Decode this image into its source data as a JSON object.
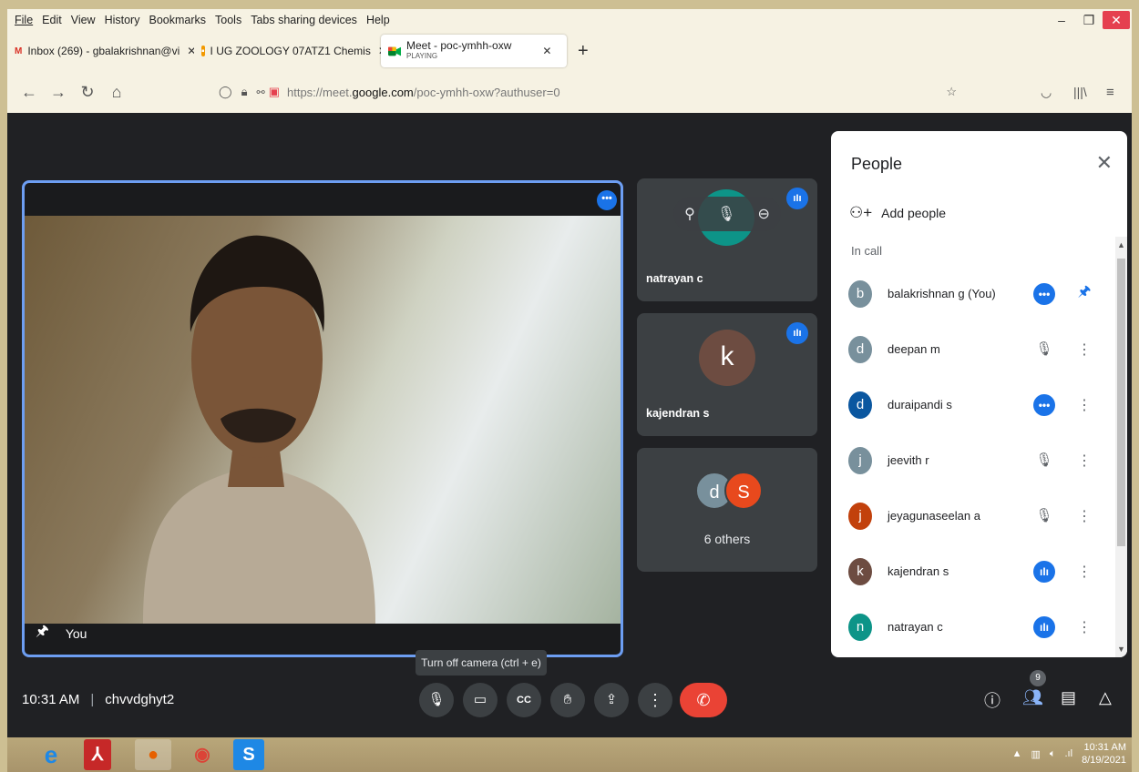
{
  "menubar": {
    "items": [
      "File",
      "Edit",
      "View",
      "History",
      "Bookmarks",
      "Tools",
      "Tabs sharing devices",
      "Help"
    ]
  },
  "tabs": [
    {
      "label": "Inbox (269) - gbalakrishnan@vi",
      "icon": "gmail-icon",
      "color": "#d93025"
    },
    {
      "label": "I UG ZOOLOGY 07ATZ1 Chemis",
      "icon": "classroom-icon",
      "color": "#f29900"
    },
    {
      "label": "Meet - poc-ymhh-oxw",
      "sub": "PLAYING",
      "icon": "meet-icon",
      "active": true
    }
  ],
  "navbar": {
    "url_prefix": "https://meet.",
    "url_domain": "google.com",
    "url_rest": "/poc-ymhh-oxw?authuser=0"
  },
  "main": {
    "self_label": "You"
  },
  "side_tiles": [
    {
      "name": "natrayan c",
      "color": "#0d9488"
    },
    {
      "name": "kajendran s",
      "avatar": "k",
      "color": "#6d4c41"
    },
    {
      "others_text": "6 others",
      "avatars": [
        {
          "letter": "d",
          "color": "#78909c"
        },
        {
          "letter": "S",
          "color": "#e8491d"
        }
      ]
    }
  ],
  "people_panel": {
    "title": "People",
    "add_label": "Add people",
    "section": "In call",
    "participants": [
      {
        "avatar": "b",
        "name": "balakrishnan g (You)",
        "color": "#78909c",
        "status": "more",
        "action": "pin"
      },
      {
        "avatar": "d",
        "name": "deepan m",
        "color": "#78909c",
        "status": "muted",
        "action": "menu"
      },
      {
        "avatar": "d",
        "name": "duraipandi s",
        "color": "#0b57a0",
        "status": "more",
        "action": "menu"
      },
      {
        "avatar": "j",
        "name": "jeevith r",
        "color": "#78909c",
        "status": "muted",
        "action": "menu"
      },
      {
        "avatar": "j",
        "name": "jeyagunaseelan a",
        "color": "#c2410c",
        "status": "muted",
        "action": "menu"
      },
      {
        "avatar": "k",
        "name": "kajendran s",
        "color": "#6d4c41",
        "status": "speaking",
        "action": "menu"
      },
      {
        "avatar": "n",
        "name": "natrayan c",
        "color": "#0d9488",
        "status": "speaking",
        "action": "menu"
      }
    ]
  },
  "bottom": {
    "time": "10:31 AM",
    "meeting_code": "chvvdghyt2",
    "tooltip": "Turn off camera (ctrl + e)",
    "people_count": "9"
  },
  "taskbar": {
    "time": "10:31 AM",
    "date": "8/19/2021"
  }
}
